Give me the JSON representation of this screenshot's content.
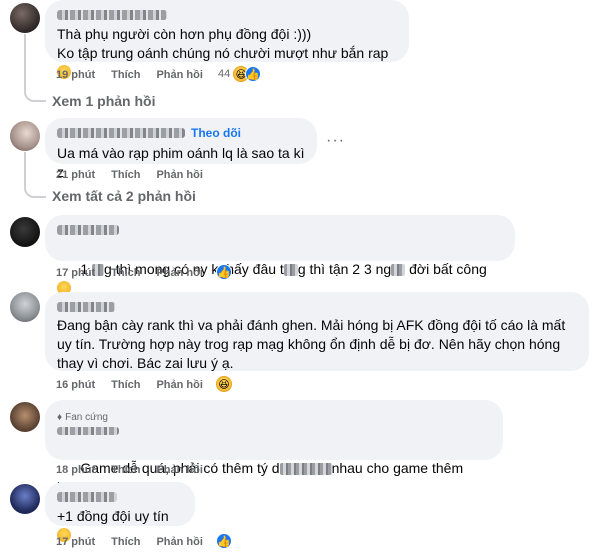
{
  "comments": [
    {
      "text": "Thà phụ người còn hơn phụ đồng đội :)))\nKo tập trung oánh chúng nó chười mượt như bắn rap",
      "time": "19 phút",
      "like": "Thích",
      "reply": "Phản hồi",
      "reaction_count": "44",
      "replies_link": "Xem 1 phản hồi"
    },
    {
      "follow": "Theo dõi",
      "text": "Ua má vào rạp phim oánh lq là sao ta kì z",
      "time": "21 phút",
      "like": "Thích",
      "reply": "Phản hồi",
      "replies_link": "Xem tất cả 2 phản hồi"
    },
    {
      "text_a": "1.",
      "text_b": "g thì mong có ny k thấy đâu t",
      "text_c": "g thì tận 2 3 ng",
      "text_d": "đời bất công",
      "time": "17 phút",
      "like": "Thích",
      "reply": "Phản hồi"
    },
    {
      "text": "Đang bận cày rank thì va phải đánh ghen. Mải hóng bị AFK đồng đội tố cáo là mất uy tín. Trường hợp này trog rạp mạg không ổn định dễ bị đơ. Nên hãy chọn hóng thay vì chơi. Bác zai lưu ý ạ.",
      "time": "16 phút",
      "like": "Thích",
      "reply": "Phản hồi"
    },
    {
      "badge": "Fan cứng",
      "text_a": "Game dễ quá, phải có thêm tý d",
      "text_b": "nhau cho game thêm kịch tính",
      "time": "18 phút",
      "like": "Thích",
      "reply": "Phản hồi"
    },
    {
      "text": "+1 đồng đội uy tín",
      "time": "17 phút",
      "like": "Thích",
      "reply": "Phản hồi"
    }
  ],
  "colors": {
    "bubble": "#f0f2f5",
    "meta": "#65676b",
    "link": "#1877f2"
  }
}
